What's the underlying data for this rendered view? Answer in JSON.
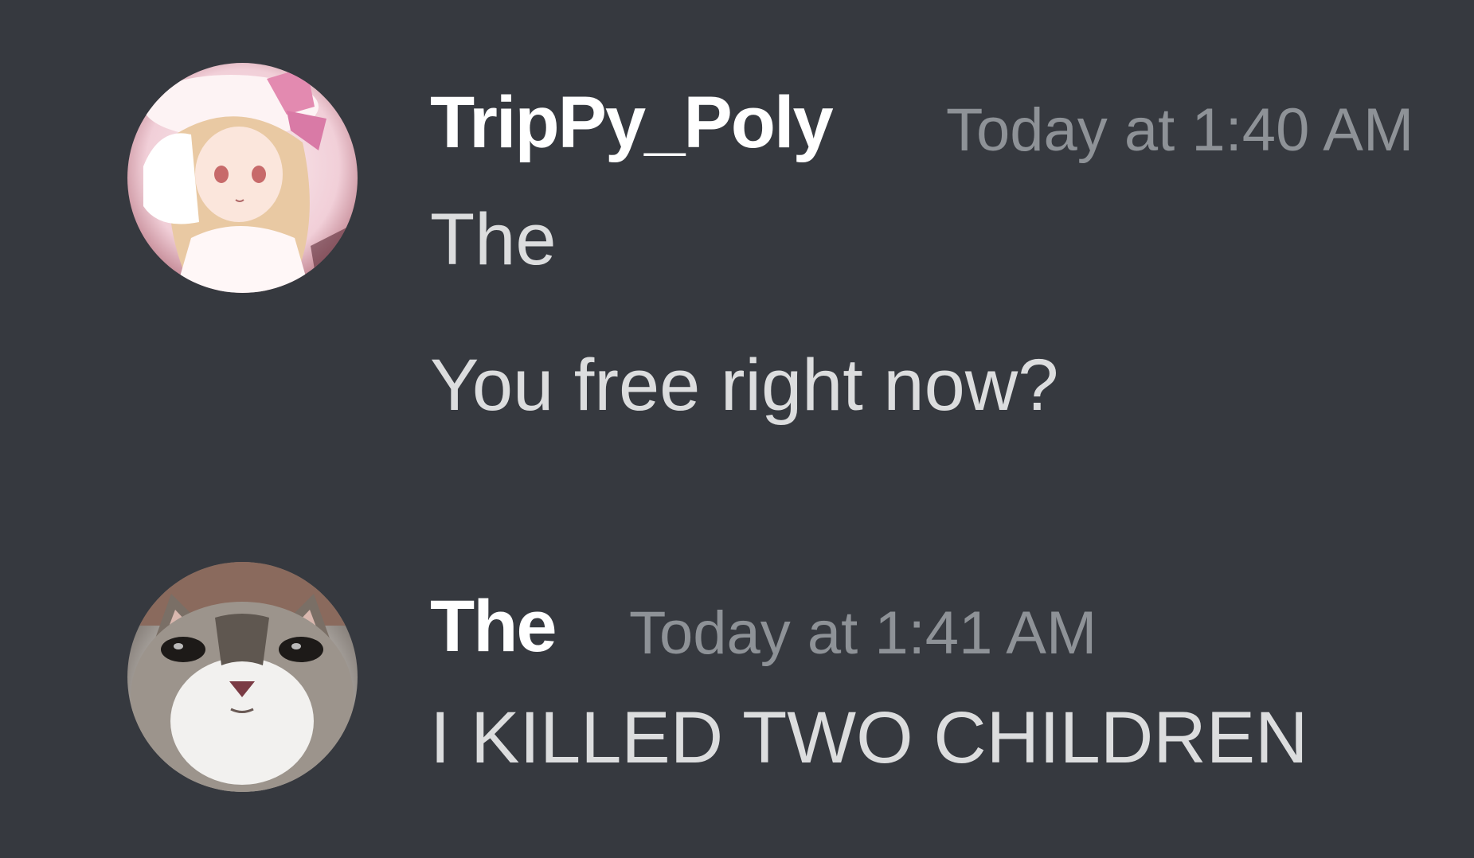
{
  "messages": [
    {
      "author": "TripPy_Poly",
      "timestamp": "Today at 1:40 AM",
      "avatar_icon": "anime-girl-avatar",
      "lines": [
        "The",
        "You free right now?"
      ]
    },
    {
      "author": "The",
      "timestamp": "Today at 1:41 AM",
      "avatar_icon": "cat-avatar",
      "lines": [
        "I KILLED TWO CHILDREN"
      ]
    }
  ],
  "colors": {
    "background": "#36393f",
    "username": "#ffffff",
    "timestamp": "#8e9297",
    "message_text": "#dcddde"
  }
}
